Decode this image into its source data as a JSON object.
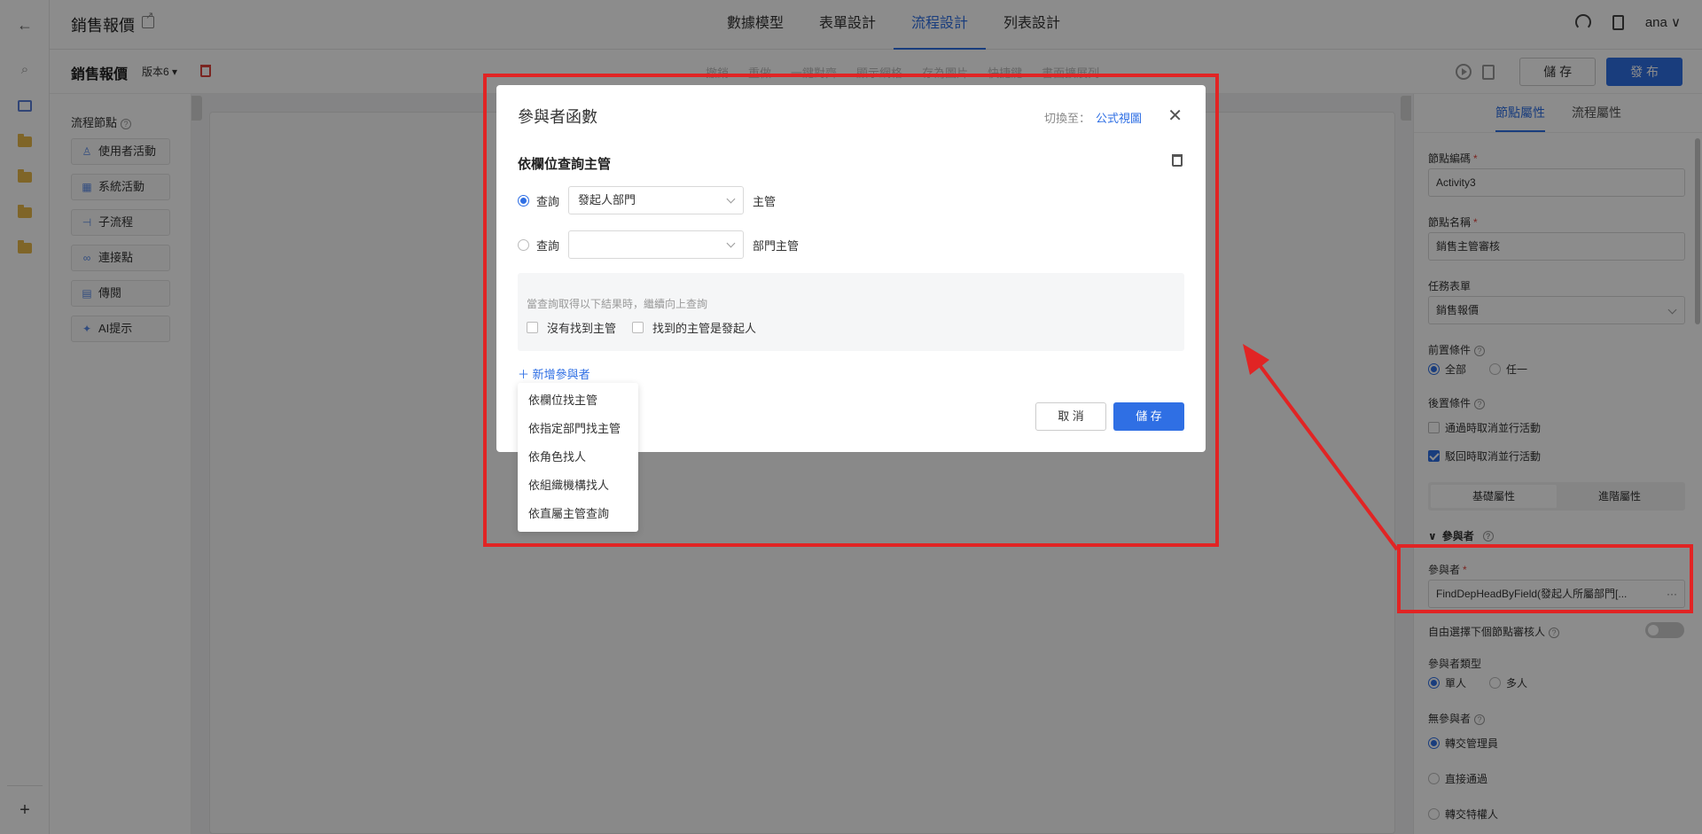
{
  "app": {
    "title": "銷售報價",
    "tabs": [
      "數據模型",
      "表單設計",
      "流程設計",
      "列表設計"
    ],
    "active_tab": "流程設計",
    "user": "ana"
  },
  "toolbar": {
    "process_name": "銷售報價",
    "version": "版本6 ▾",
    "faded_tools": [
      "撤銷",
      "重做",
      "一鍵對齊",
      "顯示網格",
      "存為圖片",
      "快捷鍵",
      "書面擴展列"
    ],
    "save_label": "儲 存",
    "publish_label": "發 布"
  },
  "nodes_panel": {
    "title": "流程節點",
    "items": [
      {
        "label": "使用者活動",
        "icon": "user-icon"
      },
      {
        "label": "系統活動",
        "icon": "grid-icon"
      },
      {
        "label": "子流程",
        "icon": "subflow-icon"
      },
      {
        "label": "連接點",
        "icon": "link-icon"
      },
      {
        "label": "傳閱",
        "icon": "doc-icon"
      },
      {
        "label": "AI提示",
        "icon": "ai-icon"
      }
    ]
  },
  "properties": {
    "tabs": [
      "節點屬性",
      "流程屬性"
    ],
    "active_tab": "節點屬性",
    "node_code_label": "節點編碼",
    "node_code_value": "Activity3",
    "node_name_label": "節點名稱",
    "node_name_value": "銷售主管審核",
    "task_form_label": "任務表單",
    "task_form_value": "銷售報價",
    "pre_condition_label": "前置條件",
    "pre_all": "全部",
    "pre_any": "任一",
    "post_condition_label": "後置條件",
    "post_opt1": "通過時取消並行活動",
    "post_opt2": "駁回時取消並行活動",
    "seg_basic": "基礎屬性",
    "seg_advanced": "進階屬性",
    "participants_section": "參與者",
    "participants_label": "參與者",
    "participants_value": "FindDepHeadByField(發起人所屬部門[...",
    "free_select_label": "自由選擇下個節點審核人",
    "participant_type_label": "參與者類型",
    "type_single": "單人",
    "type_multi": "多人",
    "no_participant_label": "無參與者",
    "np_opt1": "轉交管理員",
    "np_opt2": "直接通過",
    "np_opt3": "轉交特權人"
  },
  "modal": {
    "title": "參與者函數",
    "switch_label": "切換至：",
    "switch_link": "公式視圖",
    "subtitle": "依欄位查詢主管",
    "row1_prefix": "查詢",
    "row1_select": "發起人部門",
    "row1_suffix": "主管",
    "row2_prefix": "查詢",
    "row2_select": "",
    "row2_suffix": "部門主管",
    "hint": "當查詢取得以下結果時，繼續向上查詢",
    "check1": "沒有找到主管",
    "check2": "找到的主管是發起人",
    "add_participant": "新增參與者",
    "cancel": "取 消",
    "save": "儲 存"
  },
  "dropdown": {
    "items": [
      "依欄位找主管",
      "依指定部門找主管",
      "依角色找人",
      "依組織機構找人",
      "依直屬主管查詢"
    ]
  },
  "colors": {
    "accent": "#2f6fe4",
    "annotation": "#e12424"
  }
}
